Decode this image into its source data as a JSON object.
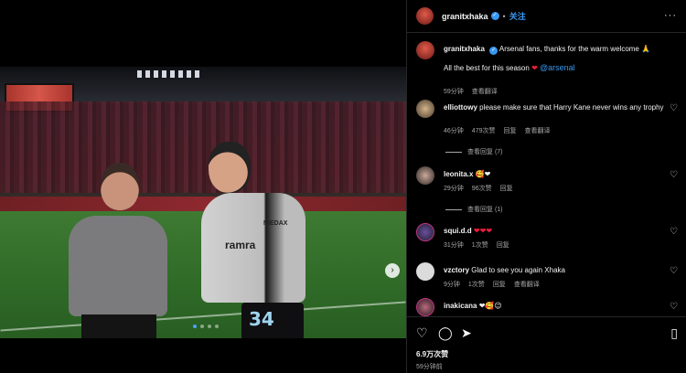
{
  "media": {
    "carousel_total": 4,
    "carousel_active": 0,
    "kit_number": "34",
    "kit_sponsor": "ramra",
    "kit_badge": "NIEDAX"
  },
  "post": {
    "author": "granitxhaka",
    "follow_label": "关注",
    "caption_line1": "Arsenal fans, thanks for the warm welcome 🙏",
    "caption_line2_text": "All the best for this season",
    "caption_mention": "@arsenal",
    "caption_time": "59分钟",
    "caption_translate": "查看翻译"
  },
  "comments": [
    {
      "user": "elliottowy",
      "text": "please make sure that Harry Kane never wins any trophy",
      "time": "46分钟",
      "likes": "479次赞",
      "reply": "回复",
      "translate": "查看翻译",
      "view_replies": "查看回复 (7)"
    },
    {
      "user": "leonita.x",
      "text": "🥰❤",
      "time": "29分钟",
      "likes": "96次赞",
      "reply": "回复",
      "view_replies": "查看回复 (1)"
    },
    {
      "user": "squi.d.d",
      "text": "❤❤❤",
      "time": "31分钟",
      "likes": "1次赞",
      "reply": "回复"
    },
    {
      "user": "vzctory",
      "text": "Glad to see you again Xhaka",
      "time": "9分钟",
      "likes": "1次赞",
      "reply": "回复",
      "translate": "查看翻译"
    },
    {
      "user": "inakicana",
      "text": "❤🥰😉"
    }
  ],
  "footer": {
    "likes": "6.9万次赞",
    "time": "59分钟前"
  },
  "colors": {
    "accent": "#3897f0",
    "heart": "#ed1c3a",
    "muted": "#a8a8a8"
  },
  "icons": [
    "heart-icon",
    "comment-icon",
    "share-icon",
    "bookmark-icon",
    "more-icon",
    "verified-icon",
    "chevron-right-icon"
  ]
}
